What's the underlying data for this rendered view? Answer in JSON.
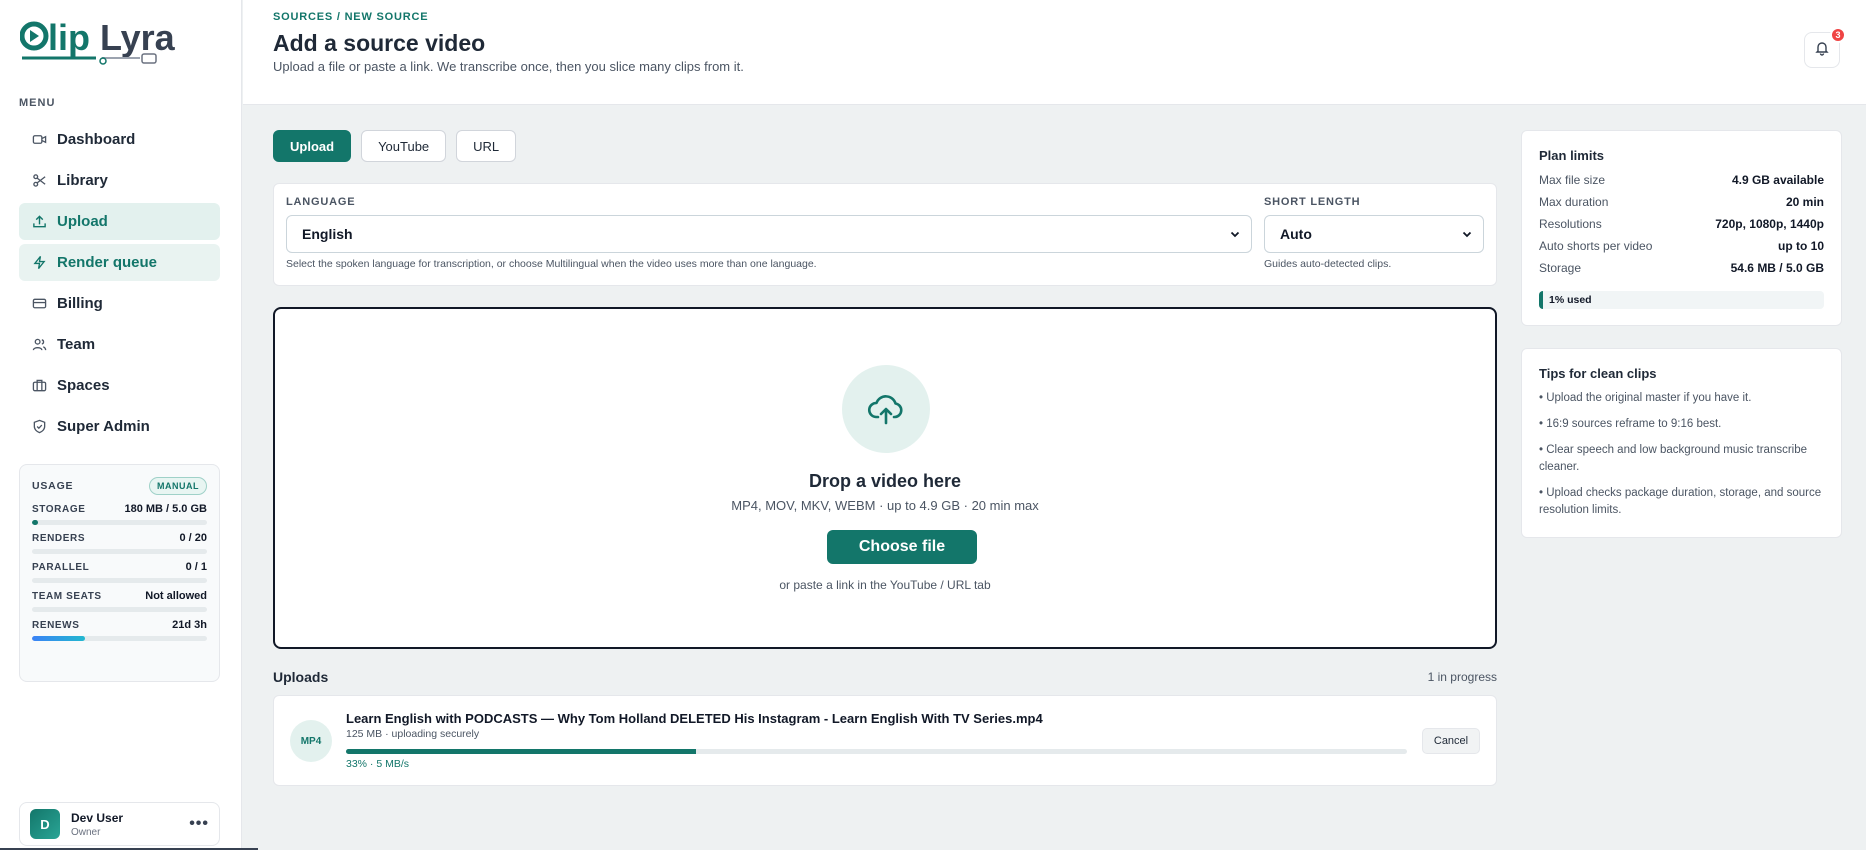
{
  "brand": {
    "name": "ClipLyra",
    "accent": "#13766a"
  },
  "sidebar": {
    "menu_label": "MENU",
    "items": [
      {
        "label": "Dashboard",
        "icon": "video-icon"
      },
      {
        "label": "Library",
        "icon": "scissors-icon"
      },
      {
        "label": "Upload",
        "icon": "upload-icon",
        "active": true
      },
      {
        "label": "Render queue",
        "icon": "bolt-icon"
      },
      {
        "label": "Billing",
        "icon": "card-icon"
      },
      {
        "label": "Team",
        "icon": "users-icon"
      },
      {
        "label": "Spaces",
        "icon": "briefcase-icon"
      },
      {
        "label": "Super Admin",
        "icon": "shield-icon"
      }
    ],
    "usage": {
      "title": "USAGE",
      "badge": "MANUAL",
      "rows": [
        {
          "label": "STORAGE",
          "value": "180 MB / 5.0 GB",
          "fill": 0.036
        },
        {
          "label": "RENDERS",
          "value": "0 / 20",
          "fill": 0
        },
        {
          "label": "PARALLEL",
          "value": "0 / 1",
          "fill": 0
        },
        {
          "label": "TEAM SEATS",
          "value": "Not allowed",
          "fill": 0
        },
        {
          "label": "RENEWS",
          "value": "21d 3h",
          "fill": 0.3
        }
      ]
    },
    "user": {
      "initial": "D",
      "name": "Dev User",
      "role": "Owner",
      "more": "•••"
    }
  },
  "header": {
    "breadcrumb": "SOURCES / NEW SOURCE",
    "title": "Add a source video",
    "subtitle": "Upload a file or paste a link. We transcribe once, then you slice many clips from it.",
    "notifications": "3"
  },
  "tabs": [
    {
      "label": "Upload",
      "active": true
    },
    {
      "label": "YouTube"
    },
    {
      "label": "URL"
    }
  ],
  "language": {
    "label": "LANGUAGE",
    "value": "English",
    "hint": "Select the spoken language for transcription, or choose Multilingual when the video uses more than one language."
  },
  "short_length": {
    "label": "SHORT LENGTH",
    "value": "Auto",
    "hint": "Guides auto-detected clips."
  },
  "dropzone": {
    "title": "Drop a video here",
    "meta": "MP4, MOV, MKV, WEBM · up to 4.9 GB · 20 min max",
    "button": "Choose file",
    "alt": "or paste a link in the YouTube / URL tab"
  },
  "uploads": {
    "title": "Uploads",
    "count": "1 in progress",
    "items": [
      {
        "type": "MP4",
        "name": "Learn English with PODCASTS — Why Tom Holland DELETED His Instagram - Learn English With TV Series.mp4",
        "sub": "125 MB · uploading securely",
        "progress_pct": 33,
        "progress_text": "33% · 5 MB/s",
        "cancel": "Cancel"
      }
    ]
  },
  "plan_limits": {
    "title": "Plan limits",
    "rows": [
      {
        "k": "Max file size",
        "v": "4.9 GB available"
      },
      {
        "k": "Max duration",
        "v": "20 min"
      },
      {
        "k": "Resolutions",
        "v": "720p, 1080p, 1440p"
      },
      {
        "k": "Auto shorts per video",
        "v": "up to 10"
      },
      {
        "k": "Storage",
        "v": "54.6 MB / 5.0 GB"
      }
    ],
    "used_text": "1% used",
    "used_fraction": 0.01
  },
  "tips": {
    "title": "Tips for clean clips",
    "items": [
      "• Upload the original master if you have it.",
      "• 16:9 sources reframe to 9:16 best.",
      "• Clear speech and low background music transcribe cleaner.",
      "• Upload checks package duration, storage, and source resolution limits."
    ]
  }
}
